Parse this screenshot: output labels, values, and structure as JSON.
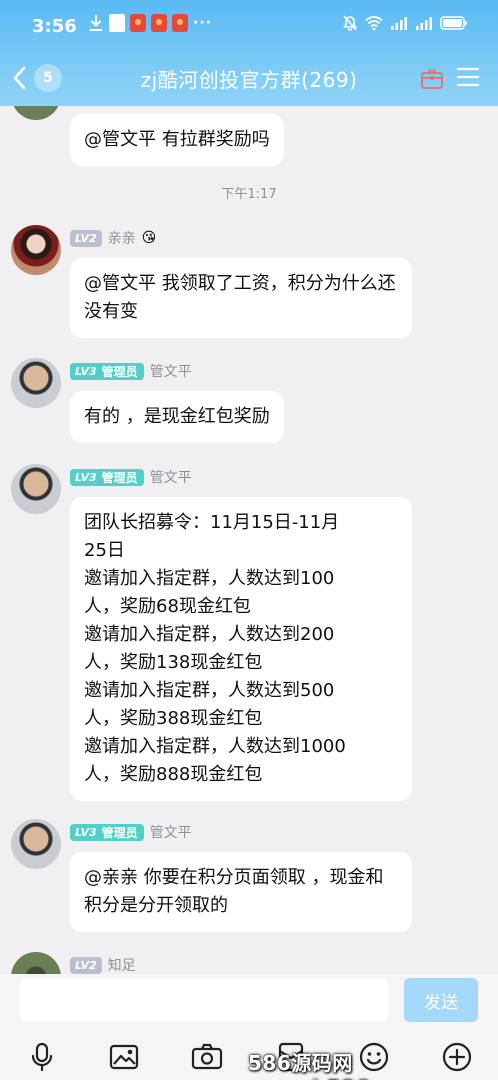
{
  "status_bar": {
    "time": "3:56",
    "dots": "···"
  },
  "header": {
    "title": "zj酷河创投官方群(269)",
    "back_count": "5"
  },
  "messages": [
    {
      "text": "@管文平 有拉群奖励吗"
    },
    {
      "timestamp": "下午1:17"
    },
    {
      "level": "LV2",
      "nickname": "亲亲",
      "emoji": "😘",
      "text": "@管文平 我领取了工资，积分为什么还没有变"
    },
    {
      "level": "LV3",
      "role": "管理员",
      "nickname": "管文平",
      "text": "有的 ，是现金红包奖励"
    },
    {
      "level": "LV3",
      "role": "管理员",
      "nickname": "管文平",
      "lines": [
        "团队长招募令：11月15日-11月",
        "25日",
        "邀请加入指定群，人数达到100",
        "人，奖励68现金红包",
        "邀请加入指定群，人数达到200",
        "人，奖励138现金红包",
        "邀请加入指定群，人数达到500",
        "人，奖励388现金红包",
        "邀请加入指定群，人数达到1000",
        "人，奖励888现金红包"
      ]
    },
    {
      "level": "LV3",
      "role": "管理员",
      "nickname": "管文平",
      "text": "@亲亲 你要在积分页面领取 ，现金和积分是分开领取的"
    },
    {
      "level": "LV2",
      "nickname": "知足"
    }
  ],
  "input": {
    "placeholder": "",
    "send_label": "发送"
  },
  "toolbar": [
    "voice-icon",
    "image-icon",
    "camera-icon",
    "red-packet-icon",
    "emoji-icon",
    "plus-icon"
  ],
  "watermark": "586源码网 www.h586.com",
  "colors": {
    "header": "#58baf3",
    "send_button": "#a4d8f8",
    "role_badge": "#52d0c7",
    "lv_gray": "#b9c0cc"
  }
}
